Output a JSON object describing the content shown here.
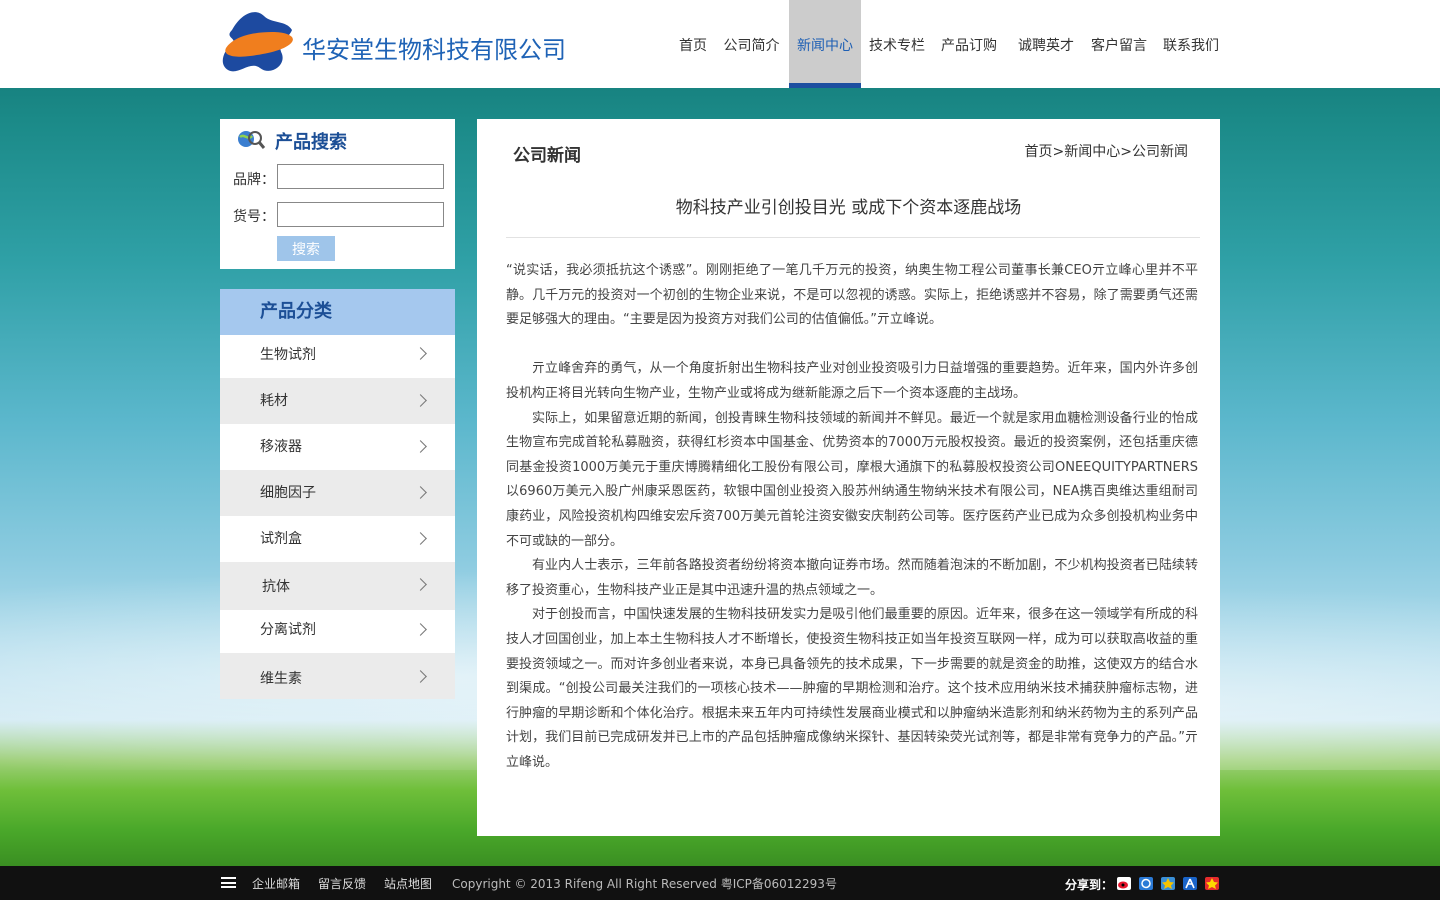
{
  "header": {
    "company_name": "华安堂生物科技有限公司",
    "nav": [
      "首页",
      "公司简介",
      "新闻中心",
      "技术专栏",
      "产品订购",
      "诚聘英才",
      "客户留言",
      "联系我们"
    ],
    "active_nav": "新闻中心"
  },
  "search": {
    "title": "产品搜索",
    "brand_label": "品牌：",
    "item_label": "货号：",
    "brand_value": "",
    "item_value": "",
    "button_label": "搜索"
  },
  "category": {
    "title": "产品分类",
    "items": [
      "生物试剂",
      "耗材",
      "移液器",
      "细胞因子",
      "试剂盒",
      "抗体",
      "分离试剂",
      "维生素"
    ]
  },
  "content": {
    "section_title": "公司新闻",
    "breadcrumb": "首页>新闻中心>公司新闻",
    "article_title": "物科技产业引创投目光 或成下个资本逐鹿战场",
    "paragraphs": [
      "“说实话，我必须抵抗这个诱惑”。刚刚拒绝了一笔几千万元的投资，纳奥生物工程公司董事长兼CEO亓立峰心里并不平静。几千万元的投资对一个初创的生物企业来说，不是可以忽视的诱惑。实际上，拒绝诱惑并不容易，除了需要勇气还需要足够强大的理由。“主要是因为投资方对我们公司的估值偏低。”亓立峰说。",
      "亓立峰舍弃的勇气，从一个角度折射出生物科技产业对创业投资吸引力日益增强的重要趋势。近年来，国内外许多创投机构正将目光转向生物产业，生物产业或将成为继新能源之后下一个资本逐鹿的主战场。",
      "实际上，如果留意近期的新闻，创投青睐生物科技领域的新闻并不鲜见。最近一个就是家用血糖检测设备行业的怡成生物宣布完成首轮私募融资，获得红杉资本中国基金、优势资本的7000万元股权投资。最近的投资案例，还包括重庆德同基金投资1000万美元于重庆博腾精细化工股份有限公司，摩根大通旗下的私募股权投资公司ONEEQUITYPARTNERS以6960万美元入股广州康采恩医药，软银中国创业投资入股苏州纳通生物纳米技术有限公司，NEA携百奥维达重组耐司康药业，风险投资机构四维安宏斥资700万美元首轮注资安徽安庆制药公司等。医疗医药产业已成为众多创投机构业务中不可或缺的一部分。",
      "有业内人士表示，三年前各路投资者纷纷将资本撤向证券市场。然而随着泡沫的不断加剧，不少机构投资者已陆续转移了投资重心，生物科技产业正是其中迅速升温的热点领域之一。",
      "对于创投而言，中国快速发展的生物科技研发实力是吸引他们最重要的原因。近年来，很多在这一领域学有所成的科技人才回国创业，加上本土生物科技人才不断增长，使投资生物科技正如当年投资互联网一样，成为可以获取高收益的重要投资领域之一。而对许多创业者来说，本身已具备领先的技术成果，下一步需要的就是资金的助推，这使双方的结合水到渠成。“创投公司最关注我们的一项核心技术——肿瘤的早期检测和治疗。这个技术应用纳米技术捕获肿瘤标志物，进行肿瘤的早期诊断和个体化治疗。根据未来五年内可持续性发展商业模式和以肿瘤纳米造影剂和纳米药物为主的系列产品计划，我们目前已完成研发并已上市的产品包括肿瘤成像纳米探针、基因转染荧光试剂等，都是非常有竞争力的产品。”亓立峰说。"
    ]
  },
  "footer": {
    "links": [
      "企业邮箱",
      "留言反馈",
      "站点地图"
    ],
    "copyright": "Copyright © 2013 Rifeng All Right Reserved 粤ICP备06012293号",
    "share_label": "分享到：",
    "share_icons": [
      "sina-weibo-icon",
      "qq-space-icon",
      "qq-favorite-icon",
      "renren-icon",
      "kaixin-icon"
    ]
  },
  "colors": {
    "brand_blue": "#1f63b6",
    "nav_active_bg": "#cccccc",
    "nav_active_bar": "#1d4fa0",
    "category_header_bg": "#a5c8ee",
    "search_button_bg": "#9fc5ea",
    "footer_bg": "#111111"
  }
}
